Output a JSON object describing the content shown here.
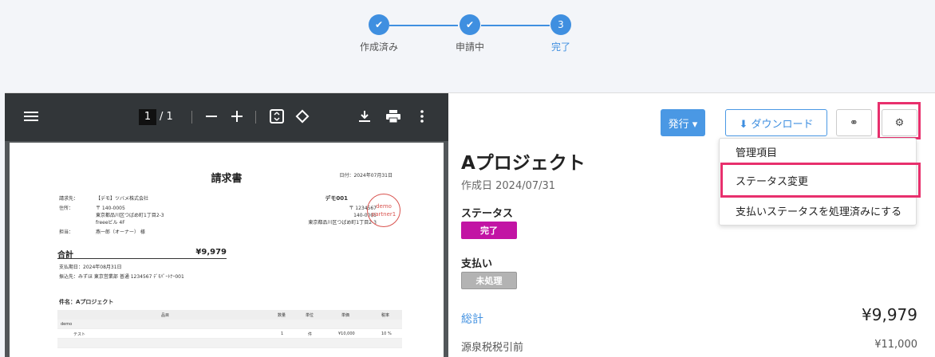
{
  "stepper": {
    "steps": [
      {
        "label": "作成済み",
        "state": "done"
      },
      {
        "label": "申請中",
        "state": "done"
      },
      {
        "label": "完了",
        "number": "3",
        "state": "current"
      }
    ],
    "check_glyph": "✔"
  },
  "viewer": {
    "page_current": "1",
    "page_total": "/ 1",
    "icons": [
      "menu-icon",
      "zoom-out-icon",
      "zoom-in-icon",
      "fit-page-icon",
      "rotate-icon",
      "download-icon",
      "print-icon",
      "more-icon"
    ]
  },
  "invoice": {
    "title": "請求書",
    "issued": "日付：2024年07月31日",
    "to_label": "請求先：",
    "to_value": "【デモ】ツバメ株式会社",
    "addr_label": "住所：",
    "addr_zip": "〒 140-0005",
    "addr_line1": "東京都品川区つばめ町1丁目2-3",
    "addr_line2": "freeeビル 4F",
    "contact_label": "担当：",
    "contact_value": "燕一郎（オーナー） 様",
    "sender_name": "デモ001",
    "sender_reg": "〒 1234567",
    "sender_zip": "140-0005",
    "sender_addr": "東京都品川区つばめ町1丁目2-3",
    "stamp_line1": "demo",
    "stamp_line2": "partner1",
    "total_label": "合計",
    "total_value": "¥9,979",
    "due": "支払期日：2024年08月31日",
    "bank": "振込先：みずほ 東京営業部 普通 1234567 ﾃﾞﾓﾊﾟｰﾄﾅｰ001",
    "subject": "件名：Aプロジェクト",
    "columns": [
      "品目",
      "数量",
      "単位",
      "単価",
      "税率"
    ],
    "group": "demo",
    "item": {
      "name": "テスト",
      "qty": "1",
      "unit": "件",
      "price": "¥10,000",
      "tax": "10 %"
    }
  },
  "panel": {
    "issue_label": "発行 ▾",
    "download_label": "⬇ ダウンロード",
    "link_icon": "⚭",
    "gear_icon": "⚙",
    "title": "Aプロジェクト",
    "created": "作成日 2024/07/31",
    "status_label": "ステータス",
    "status_value": "完了",
    "payment_label": "支払い",
    "payment_value": "未処理",
    "sum_label": "総計",
    "sum_value": "¥9,979",
    "withholding_label": "源泉税税引前",
    "withholding_value": "¥11,000"
  },
  "menu": {
    "items": [
      "管理項目",
      "ステータス変更",
      "支払いステータスを処理済みにする"
    ]
  },
  "colors": {
    "accent": "#3f8fe0",
    "highlight": "#e8306d",
    "status_done": "#c214a4",
    "status_unpaid": "#b3b3b3"
  }
}
